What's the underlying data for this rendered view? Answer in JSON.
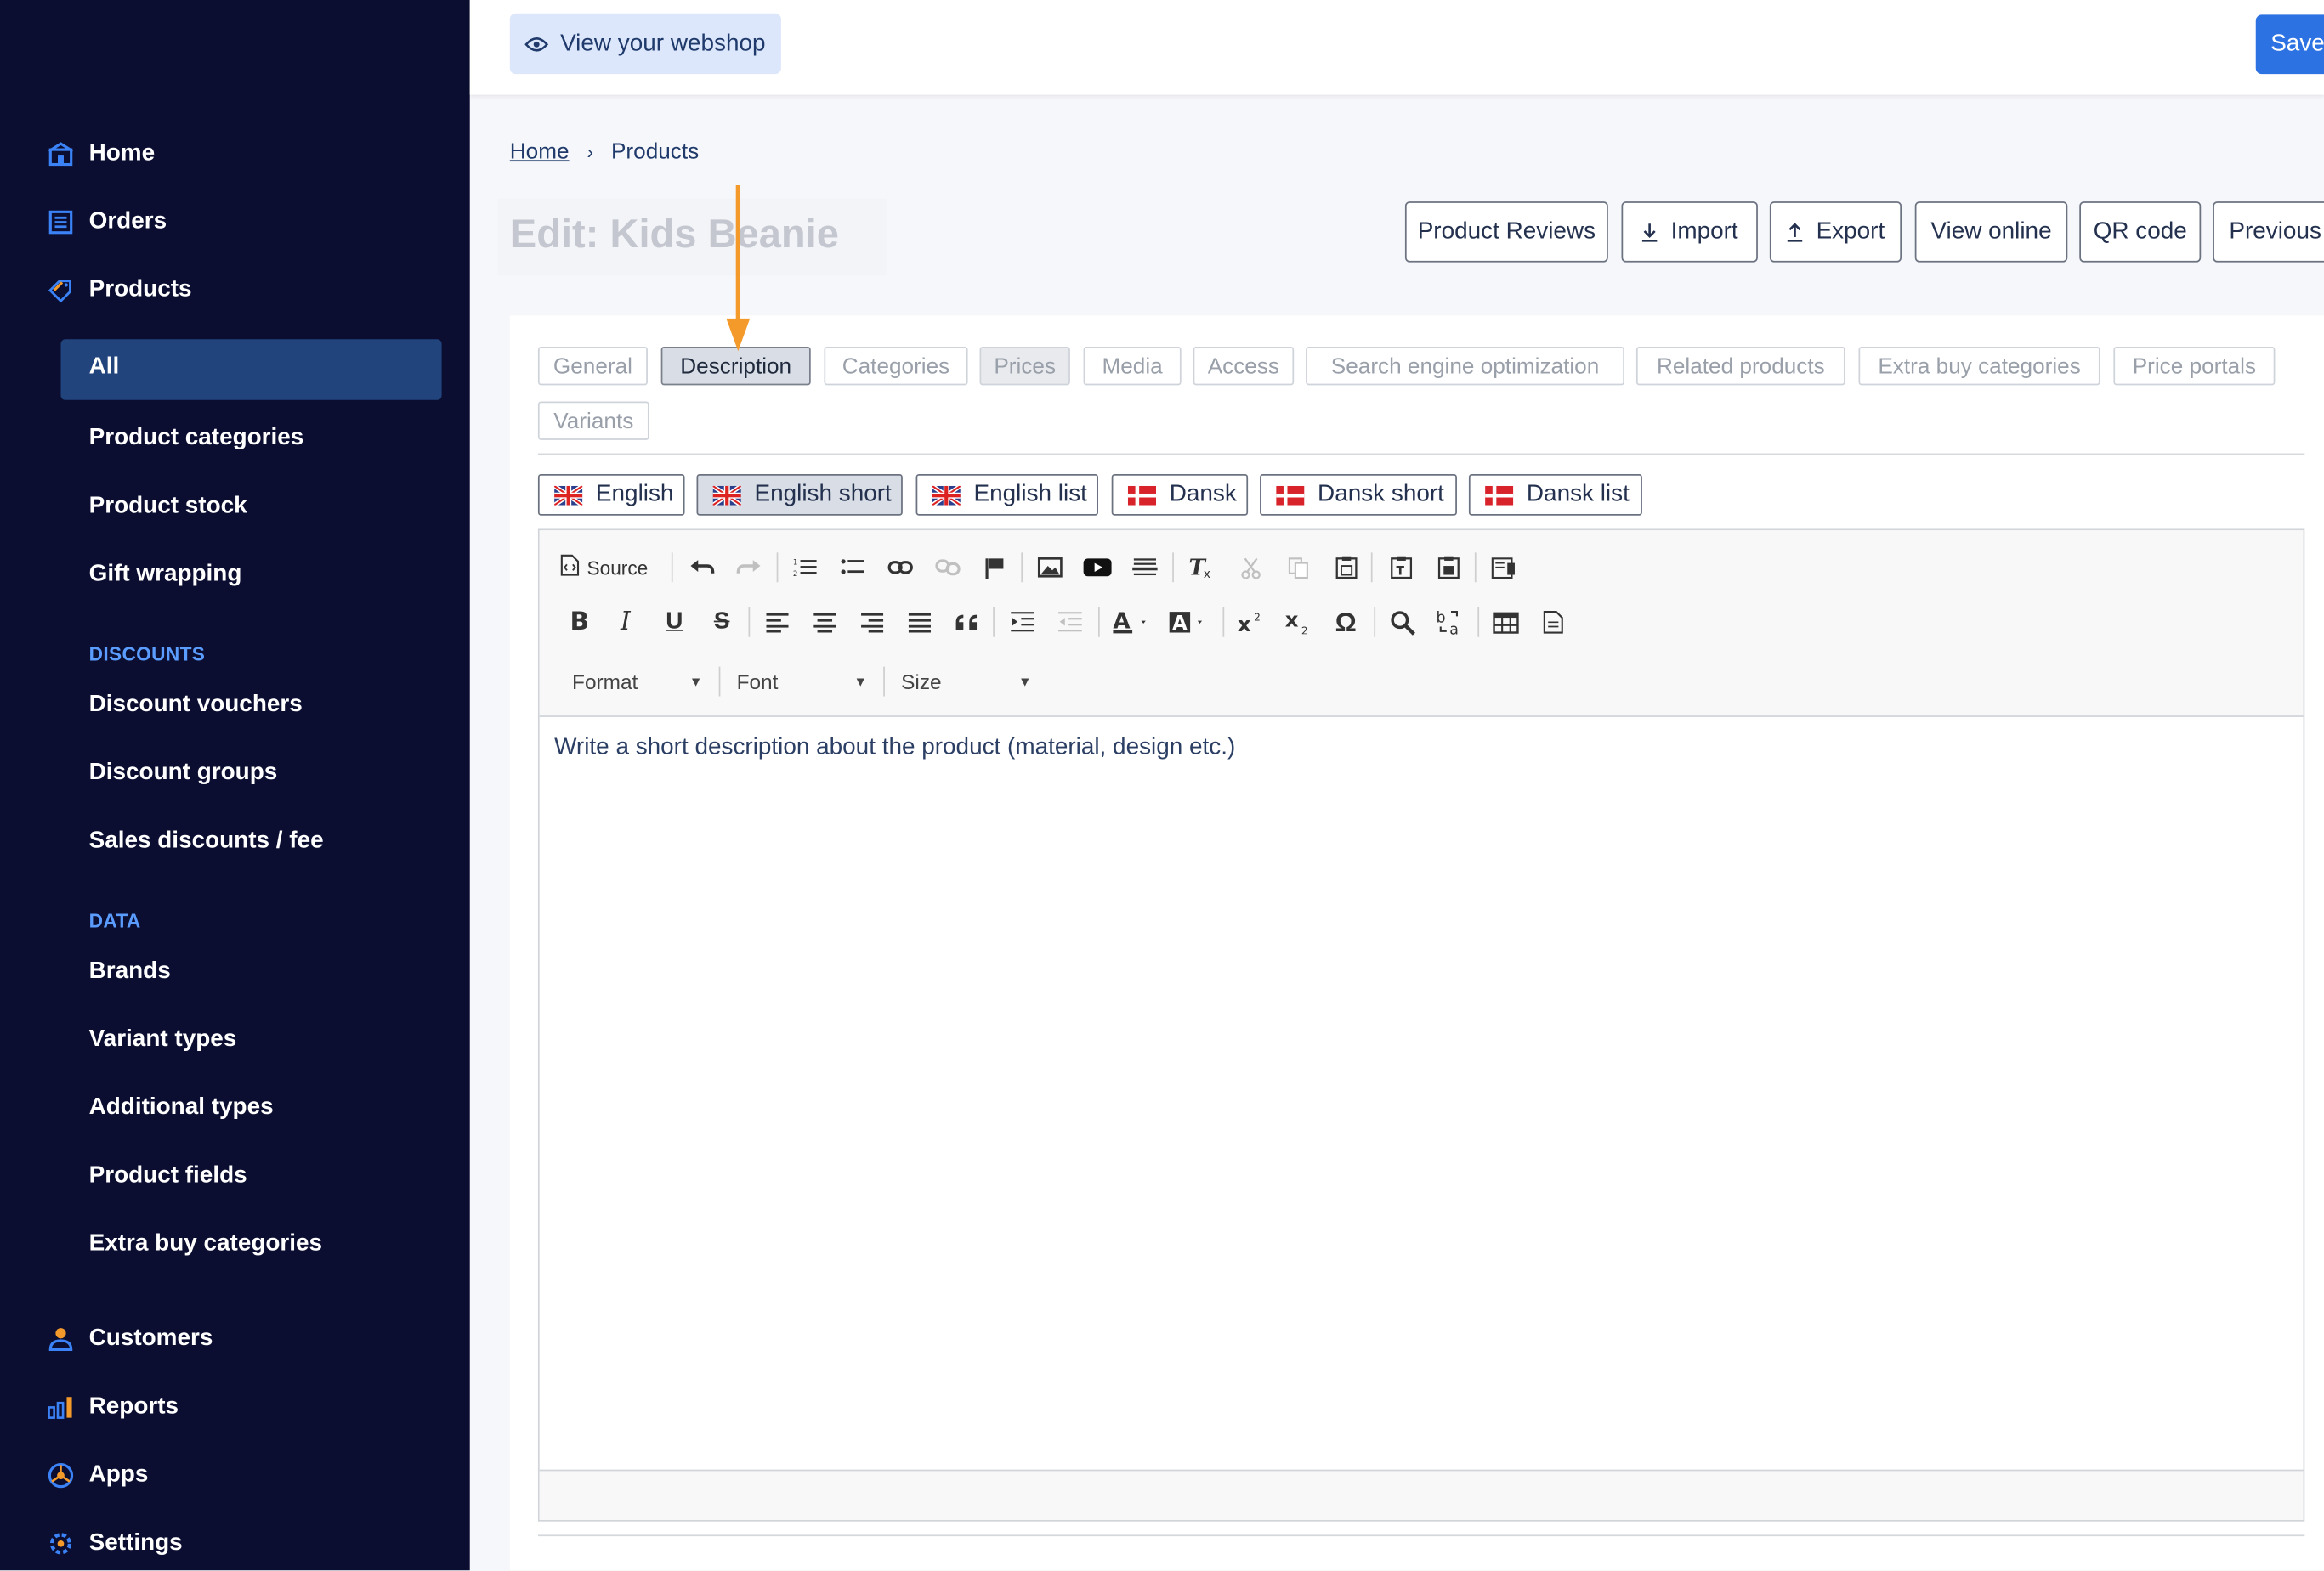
{
  "sidebar": {
    "nav": [
      {
        "label": "Home",
        "icon": "home-icon"
      },
      {
        "label": "Orders",
        "icon": "orders-icon"
      },
      {
        "label": "Products",
        "icon": "tag-icon"
      }
    ],
    "products_sub": [
      "All",
      "Product categories",
      "Product stock",
      "Gift wrapping"
    ],
    "discounts_heading": "DISCOUNTS",
    "discounts": [
      "Discount vouchers",
      "Discount groups",
      "Sales discounts / fee"
    ],
    "data_heading": "DATA",
    "data": [
      "Brands",
      "Variant types",
      "Additional types",
      "Product fields",
      "Extra buy categories"
    ],
    "bottom_nav": [
      {
        "label": "Customers",
        "icon": "customers-icon"
      },
      {
        "label": "Reports",
        "icon": "reports-icon"
      },
      {
        "label": "Apps",
        "icon": "apps-icon"
      },
      {
        "label": "Settings",
        "icon": "settings-icon"
      }
    ],
    "active_item": "All"
  },
  "topbar": {
    "view_webshop": "View your webshop",
    "save": "Save"
  },
  "breadcrumb": {
    "home": "Home",
    "current": "Products"
  },
  "page_title": "Edit: Kids Beanie",
  "actions": [
    "Product Reviews",
    "Import",
    "Export",
    "View online",
    "QR code",
    "Previous"
  ],
  "tabs": [
    "General",
    "Description",
    "Categories",
    "Prices",
    "Media",
    "Access",
    "Search engine optimization",
    "Related products",
    "Extra buy categories",
    "Price portals",
    "Variants"
  ],
  "active_tab": "Description",
  "language_tabs": [
    "English",
    "English short",
    "English list",
    "Dansk",
    "Dansk short",
    "Dansk list"
  ],
  "active_language_tab": "English short",
  "editor": {
    "source_label": "Source",
    "format_label": "Format",
    "font_label": "Font",
    "size_label": "Size",
    "content": "Write a short description about the product (material, design etc.)"
  },
  "colors": {
    "sidebar_bg": "#0b0e30",
    "active_bg": "#21447d",
    "accent": "#2d72e3",
    "section_heading": "#5a9cff",
    "annotation_arrow": "#f39a2b"
  }
}
